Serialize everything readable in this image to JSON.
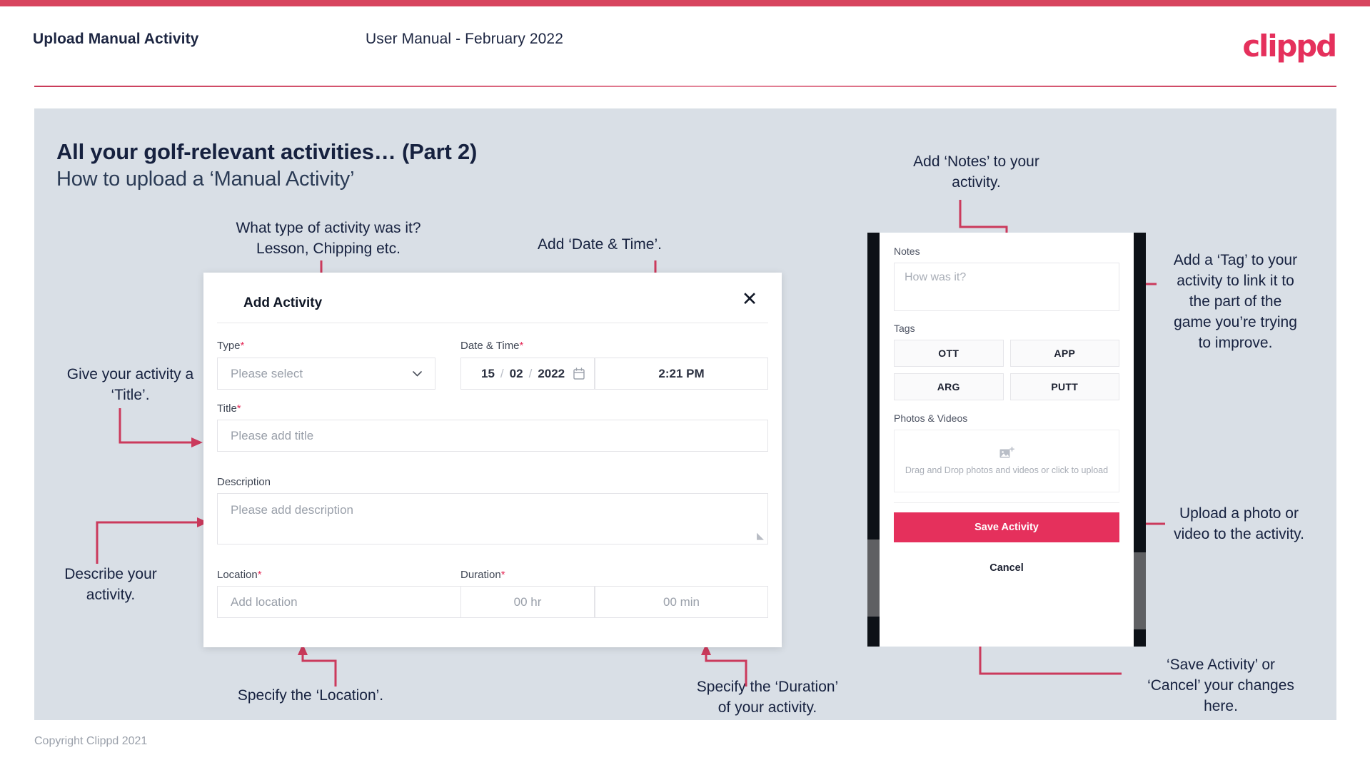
{
  "header": {
    "left_title": "Upload Manual Activity",
    "center_title": "User Manual - February 2022",
    "logo": "clippd"
  },
  "slide": {
    "title": "All your golf-relevant activities… (Part 2)",
    "subtitle": "How to upload a ‘Manual Activity’"
  },
  "annotations": {
    "type": "What type of activity was it?\nLesson, Chipping etc.",
    "datetime": "Add ‘Date & Time’.",
    "title": "Give your activity a\n‘Title’.",
    "description": "Describe your\nactivity.",
    "location": "Specify the ‘Location’.",
    "duration": "Specify the ‘Duration’\nof your activity.",
    "notes": "Add ‘Notes’ to your\nactivity.",
    "tags": "Add a ‘Tag’ to your\nactivity to link it to\nthe part of the\ngame you’re trying\nto improve.",
    "photos": "Upload a photo or\nvideo to the activity.",
    "save": "‘Save Activity’ or\n‘Cancel’ your changes\nhere."
  },
  "modal": {
    "title": "Add Activity",
    "close_icon": "close-icon",
    "fields": {
      "type": {
        "label": "Type",
        "required": "*",
        "placeholder": "Please select",
        "chevron_icon": "chevron-down-icon"
      },
      "datetime": {
        "label": "Date & Time",
        "required": "*",
        "day": "15",
        "sep1": "/",
        "month": "02",
        "sep2": "/",
        "year": "2022",
        "calendar_icon": "calendar-icon",
        "time": "2:21 PM"
      },
      "title": {
        "label": "Title",
        "required": "*",
        "placeholder": "Please add title"
      },
      "description": {
        "label": "Description",
        "required": "",
        "placeholder": "Please add description"
      },
      "location": {
        "label": "Location",
        "required": "*",
        "placeholder": "Add location"
      },
      "duration": {
        "label": "Duration",
        "required": "*",
        "hours_placeholder": "00 hr",
        "minutes_placeholder": "00 min"
      }
    }
  },
  "phone": {
    "notes": {
      "label": "Notes",
      "placeholder": "How was it?"
    },
    "tags": {
      "label": "Tags",
      "items": [
        "OTT",
        "APP",
        "ARG",
        "PUTT"
      ]
    },
    "photos": {
      "label": "Photos & Videos",
      "icon": "add-image-icon",
      "dropzone_text": "Drag and Drop photos and videos or click to upload"
    },
    "save_label": "Save Activity",
    "cancel_label": "Cancel"
  },
  "footer": {
    "copyright": "Copyright Clippd 2021"
  },
  "colors": {
    "brand": "#e5305c",
    "bar": "#d8455f",
    "slide_bg": "#d9dfe6",
    "text_dark": "#16213f",
    "arrow": "#cb3a5c"
  }
}
